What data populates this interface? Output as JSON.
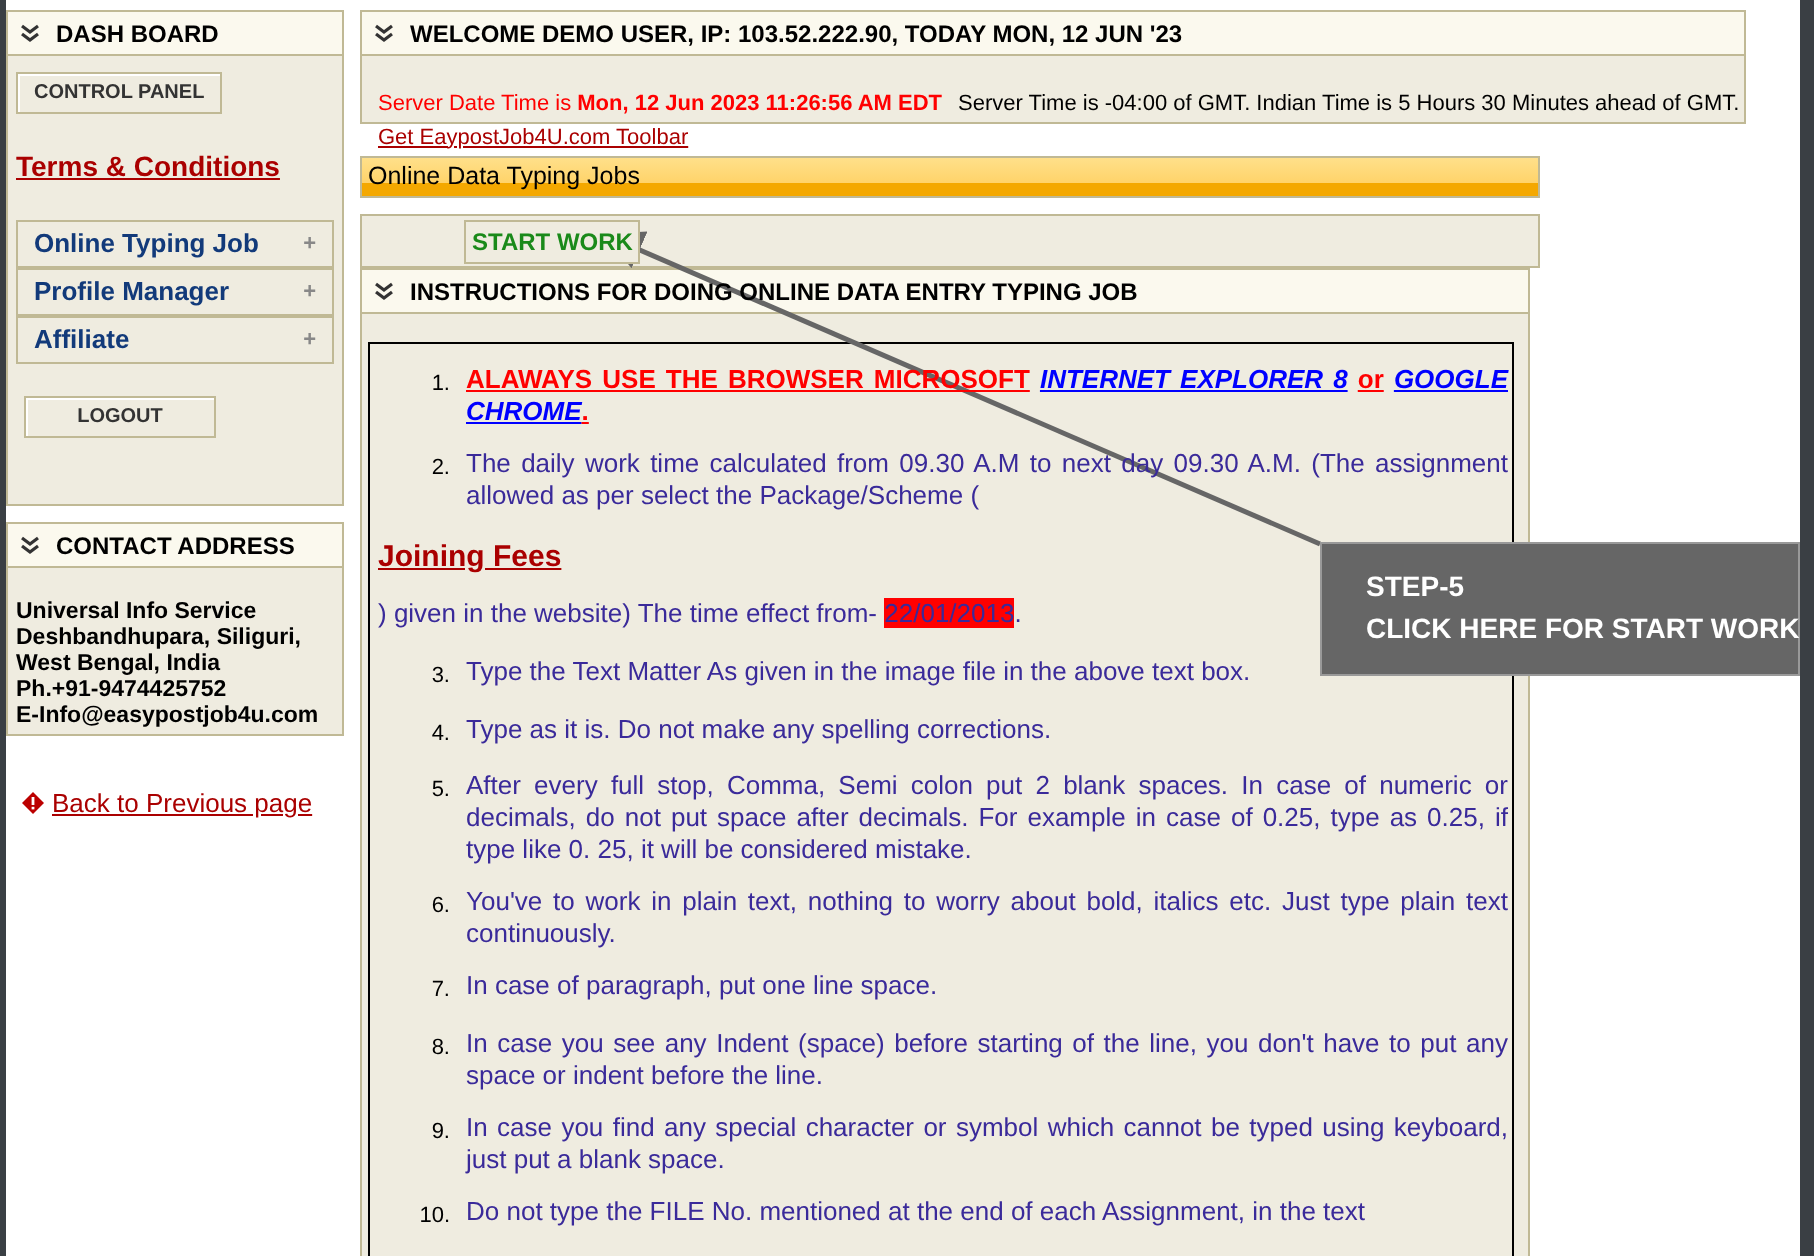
{
  "sidebar": {
    "dashboard": {
      "title": "DASH BOARD",
      "control_panel": "CONTROL PANEL",
      "terms_link": "Terms & Conditions",
      "menu": [
        {
          "label": "Online Typing Job",
          "toggle": "+"
        },
        {
          "label": "Profile Manager",
          "toggle": "+"
        },
        {
          "label": "Affiliate",
          "toggle": "+"
        }
      ],
      "logout": "LOGOUT"
    },
    "contact": {
      "title": "CONTACT ADDRESS",
      "lines": [
        "Universal Info Service",
        "Deshbandhupara, Siliguri,",
        "West Bengal, India",
        "Ph.+91-9474425752",
        "E-Info@easypostjob4u.com"
      ]
    },
    "back_link": {
      "label": "Back to Previous page"
    }
  },
  "welcome": {
    "title": "WELCOME DEMO USER, IP: 103.52.222.90, TODAY MON, 12 JUN '23",
    "server_label": "Server Date Time is ",
    "server_time": "Mon, 12 Jun 2023 11:26:56 AM EDT",
    "gmt_note": "Server Time is -04:00 of GMT. Indian Time is 5 Hours 30 Minutes ahead of GMT.",
    "toolbar_link": "Get EaypostJob4U.com Toolbar"
  },
  "jobs_bar": {
    "title": "Online Data Typing Jobs"
  },
  "start_button": "START WORK",
  "instructions": {
    "title": "INSTRUCTIONS FOR DOING ONLINE DATA ENTRY TYPING JOB",
    "blocks": [
      {
        "kind": "segments",
        "number": "1.",
        "segments": [
          {
            "kind": "warning",
            "text": "ALAWAYS USE THE BROWSER MICROSOFT"
          },
          {
            "kind": "browser",
            "text": "INTERNET EXPLORER 8"
          },
          {
            "kind": "warning",
            "text": "or"
          },
          {
            "kind": "browser",
            "text": "GOOGLE CHROME"
          },
          {
            "kind": "warning",
            "text": "."
          }
        ]
      },
      {
        "kind": "item",
        "number": "2.",
        "text": "The daily work time calculated from 09.30 A.M to next day 09.30 A.M. (The assignment  allowed as per select the Package/Scheme ("
      },
      {
        "kind": "heading",
        "text": "Joining Fees"
      },
      {
        "kind": "date_line",
        "text": ") given in the website) The time effect from- ",
        "highlight": "22/01/2013",
        "after": "."
      },
      {
        "kind": "item",
        "number": "3.",
        "text": "Type the Text Matter As given in the image file in the above text box."
      },
      {
        "kind": "item",
        "number": "4.",
        "text": "Type as it is. Do not make any spelling corrections."
      },
      {
        "kind": "item",
        "number": "5.",
        "text": "After every full stop, Comma, Semi colon put 2 blank spaces. In case of numeric or decimals, do not put space after decimals. For example in case of 0.25, type as 0.25, if type like 0. 25, it will be considered mistake."
      },
      {
        "kind": "item",
        "number": "6.",
        "text": "You've to work in plain text, nothing to worry about bold, italics etc. Just type plain text continuously."
      },
      {
        "kind": "item",
        "number": "7.",
        "text": "In case of paragraph, put one line space."
      },
      {
        "kind": "item",
        "number": "8.",
        "text": "In case you see any Indent (space) before starting of the line, you don't have to put any space or indent before the line."
      },
      {
        "kind": "item",
        "number": "9.",
        "text": "In case you find any special character or symbol which cannot be typed using keyboard, just put a blank space."
      },
      {
        "kind": "item",
        "number": "10.",
        "text": "Do not type the FILE No. mentioned at the end of each Assignment, in the text"
      }
    ]
  },
  "callout": {
    "step": "STEP-5",
    "text": "CLICK HERE FOR START WORK"
  }
}
